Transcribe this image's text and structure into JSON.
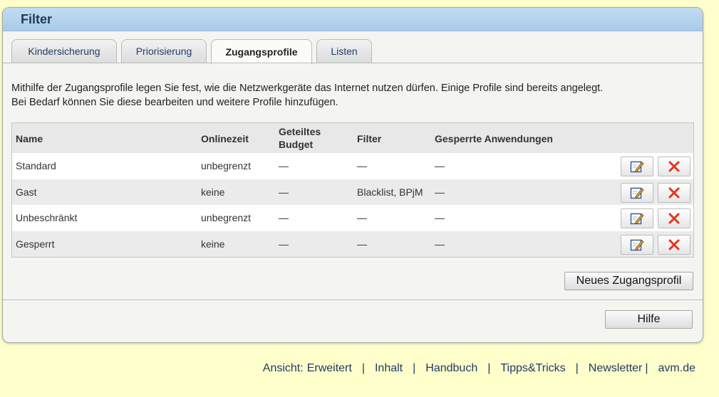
{
  "panel": {
    "title": "Filter"
  },
  "tabs": [
    {
      "label": "Kindersicherung",
      "active": false
    },
    {
      "label": "Priorisierung",
      "active": false
    },
    {
      "label": "Zugangsprofile",
      "active": true
    },
    {
      "label": "Listen",
      "active": false
    }
  ],
  "intro": {
    "line1": "Mithilfe der Zugangsprofile legen Sie fest, wie die Netzwerkgeräte das Internet nutzen dürfen. Einige Profile sind bereits angelegt.",
    "line2": "Bei Bedarf können Sie diese bearbeiten und weitere Profile hinzufügen."
  },
  "table": {
    "headers": {
      "name": "Name",
      "online": "Onlinezeit",
      "budget_line1": "Geteiltes",
      "budget_line2": "Budget",
      "filter": "Filter",
      "blocked": "Gesperrte Anwendungen"
    },
    "rows": [
      {
        "name": "Standard",
        "online": "unbegrenzt",
        "budget": "—",
        "filter": "—",
        "blocked": "—"
      },
      {
        "name": "Gast",
        "online": "keine",
        "budget": "—",
        "filter": "Blacklist, BPjM",
        "blocked": "—"
      },
      {
        "name": "Unbeschränkt",
        "online": "unbegrenzt",
        "budget": "—",
        "filter": "—",
        "blocked": "—"
      },
      {
        "name": "Gesperrt",
        "online": "keine",
        "budget": "—",
        "filter": "—",
        "blocked": "—"
      }
    ]
  },
  "buttons": {
    "new_profile": "Neues Zugangsprofil",
    "help": "Hilfe"
  },
  "icons": {
    "edit": "edit-icon",
    "delete": "delete-icon"
  },
  "colors": {
    "header_bg": "#b5d3ee",
    "page_bg": "#ffffcc",
    "delete_red": "#e8341c",
    "link": "#1c3d62"
  },
  "footer": {
    "view_prefix": "Ansicht:",
    "view_link": "Erweitert",
    "links": [
      "Inhalt",
      "Handbuch",
      "Tipps&Tricks",
      "Newsletter",
      "avm.de"
    ]
  }
}
